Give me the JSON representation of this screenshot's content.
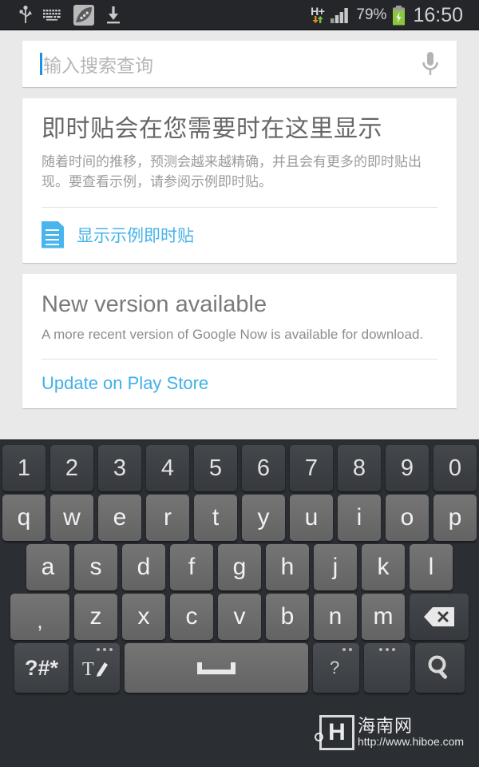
{
  "status_bar": {
    "left_icons": [
      "usb-icon",
      "keyboard-icon",
      "app-icon",
      "download-icon"
    ],
    "network_type": "H+",
    "network_arrows": "↓↑",
    "signal": "signal-bars-icon",
    "battery_percent": "79%",
    "battery_state": "charging",
    "clock": "16:50",
    "colors": {
      "bar_bg": "#24262a",
      "battery_green": "#8cc63f",
      "text": "#d2d2d2"
    }
  },
  "search": {
    "placeholder": "输入搜索查询",
    "value": "",
    "mic_icon": "microphone-icon",
    "caret_color": "#1e90e0"
  },
  "cards": [
    {
      "title": "即时贴会在您需要时在这里显示",
      "body": "随着时间的推移，预测会越来越精确，并且会有更多的即时贴出现。要查看示例，请参阅示例即时贴。",
      "action_icon": "document-icon",
      "action_label": "显示示例即时贴",
      "accent": "#45b3ea"
    },
    {
      "title": "New version available",
      "body": "A more recent version of Google Now is available for download.",
      "action_label": "Update on Play Store",
      "accent": "#3fb0e8"
    }
  ],
  "keyboard": {
    "rows": [
      {
        "id": "row-num",
        "style": "dark",
        "keys": [
          "1",
          "2",
          "3",
          "4",
          "5",
          "6",
          "7",
          "8",
          "9",
          "0"
        ]
      },
      {
        "id": "row-1",
        "style": "light",
        "keys": [
          "q",
          "w",
          "e",
          "r",
          "t",
          "y",
          "u",
          "i",
          "o",
          "p"
        ]
      },
      {
        "id": "row-2",
        "style": "light",
        "keys": [
          "a",
          "s",
          "d",
          "f",
          "g",
          "h",
          "j",
          "k",
          "l"
        ]
      },
      {
        "id": "row-3",
        "style": "light",
        "keys": [
          "z",
          "x",
          "c",
          "v",
          "b",
          "n",
          "m"
        ]
      }
    ],
    "comma_key": ",",
    "backspace_key": "backspace-icon",
    "bottom_row": {
      "symbols_key": "?#*",
      "handwriting_key": "handwriting-icon",
      "space_key": "space-icon",
      "emoji_key": "emoji-question-icon",
      "options_key": "more-options-icon",
      "search_key": "search-icon"
    }
  },
  "watermark": {
    "logo": "H",
    "site_name": "海南网",
    "url": "http://www.hiboe.com"
  }
}
